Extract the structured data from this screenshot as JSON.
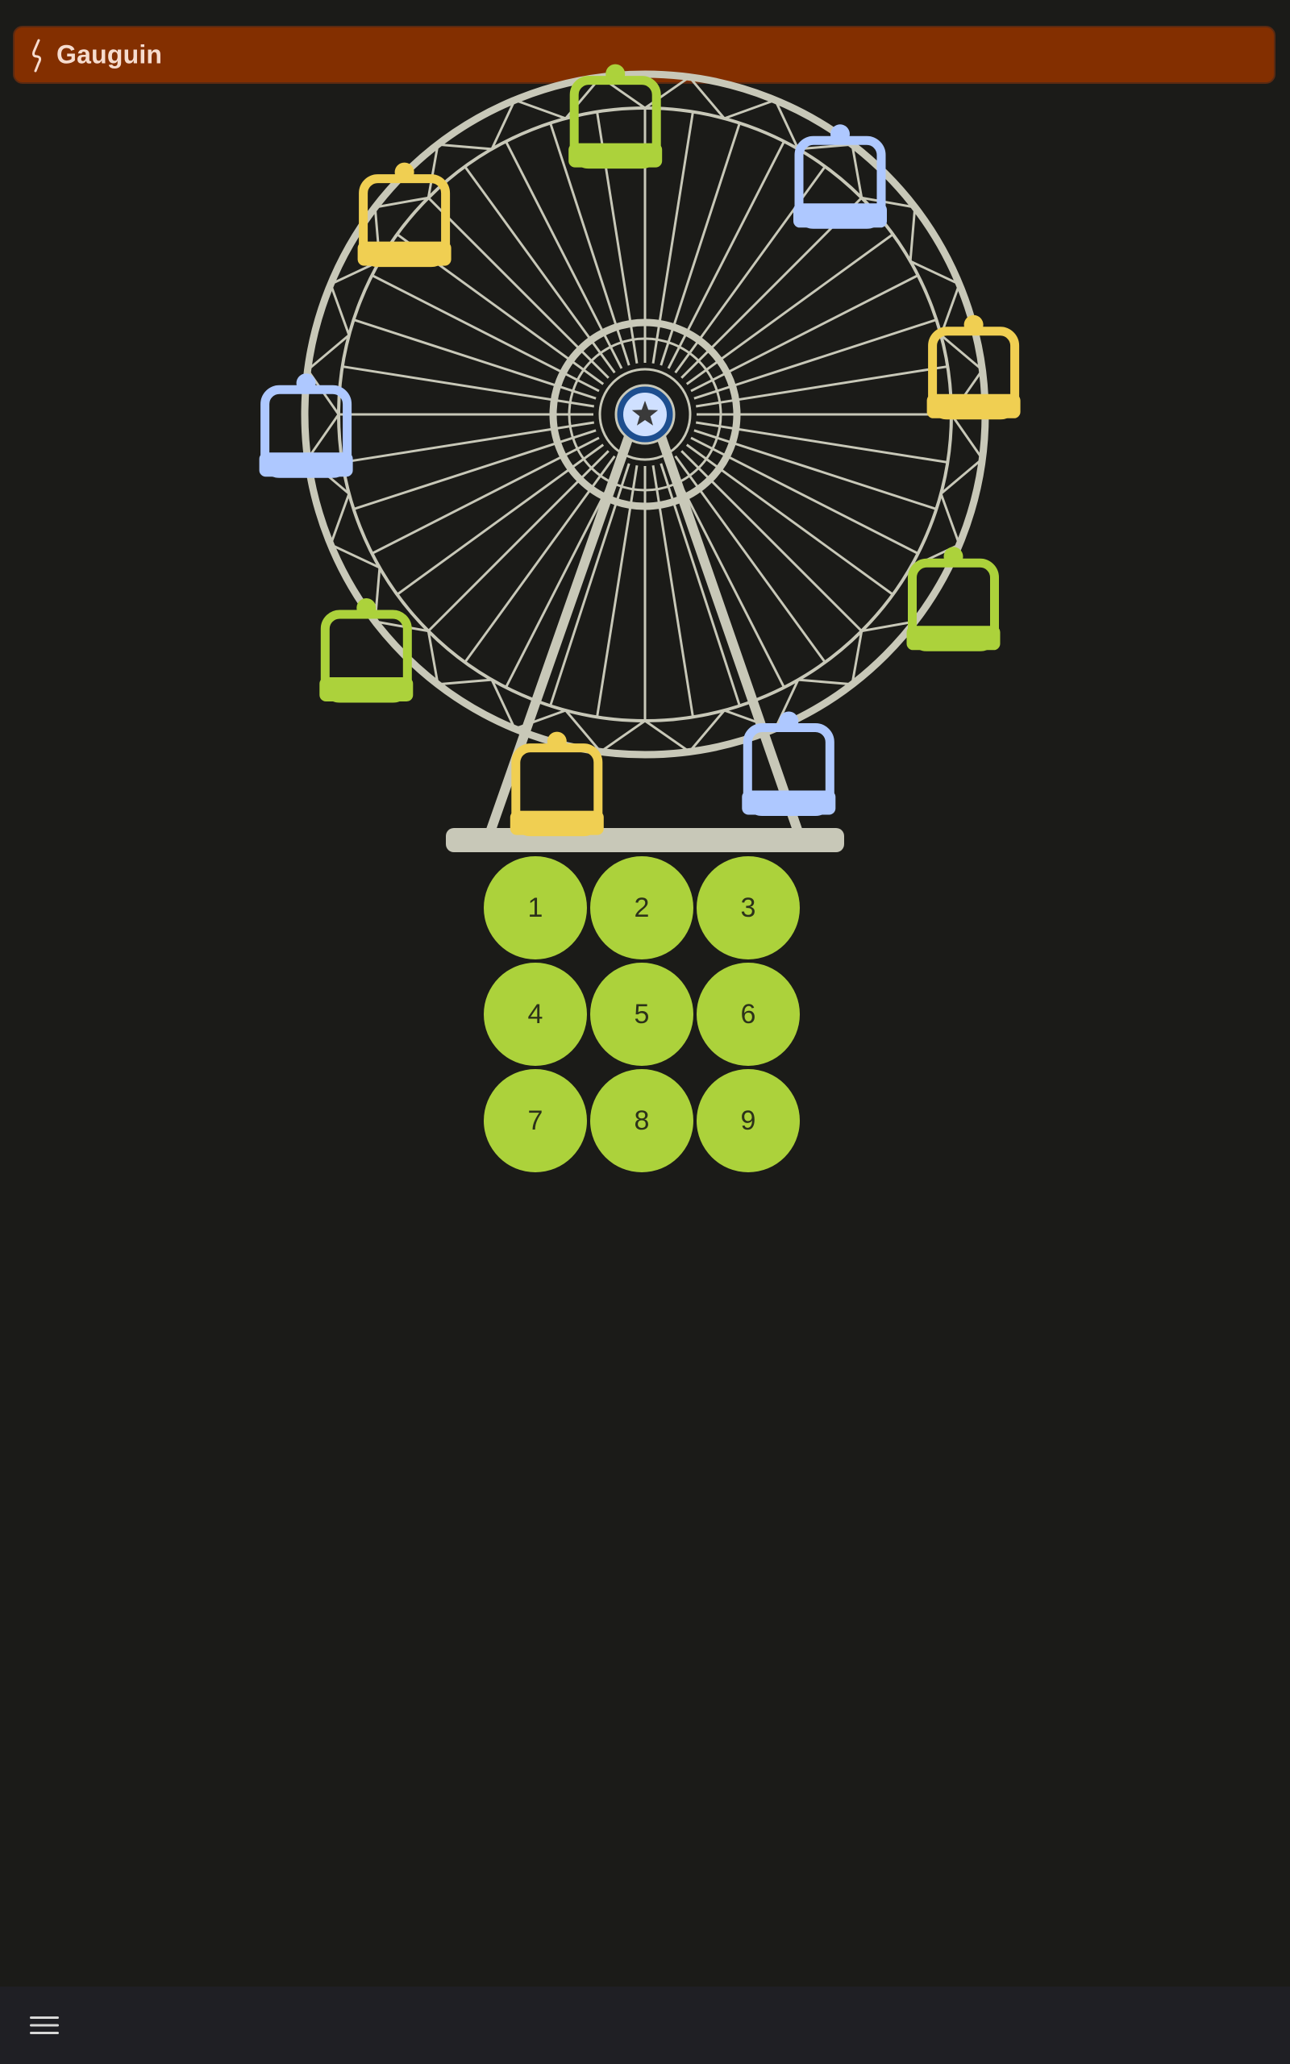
{
  "app": {
    "title": "Gauguin"
  },
  "colors": {
    "title_bar_bg": "#832f00",
    "title_text": "#f6dccf",
    "background": "#1b1b18",
    "wheel_frame": "#c8c8b8",
    "hub_outer": "#1d4e8f",
    "hub_inner": "#cfe0ff",
    "key_fill": "#acd23b",
    "key_text": "#2c321a",
    "gondola_yellow": "#f0cf52",
    "gondola_green": "#acd23b",
    "gondola_blue": "#aec8ff",
    "bottom_bar": "#1f1f24",
    "menu_icon": "#d8d8d8"
  },
  "illustration": {
    "name": "ferris-wheel",
    "hub_icon": "star-icon",
    "gondola_colors": [
      "green",
      "blue",
      "yellow",
      "green",
      "blue",
      "yellow",
      "green",
      "blue",
      "yellow"
    ]
  },
  "keypad": {
    "keys": [
      "1",
      "2",
      "3",
      "4",
      "5",
      "6",
      "7",
      "8",
      "9"
    ]
  },
  "bottom_bar": {
    "menu_icon": "hamburger-menu-icon"
  }
}
